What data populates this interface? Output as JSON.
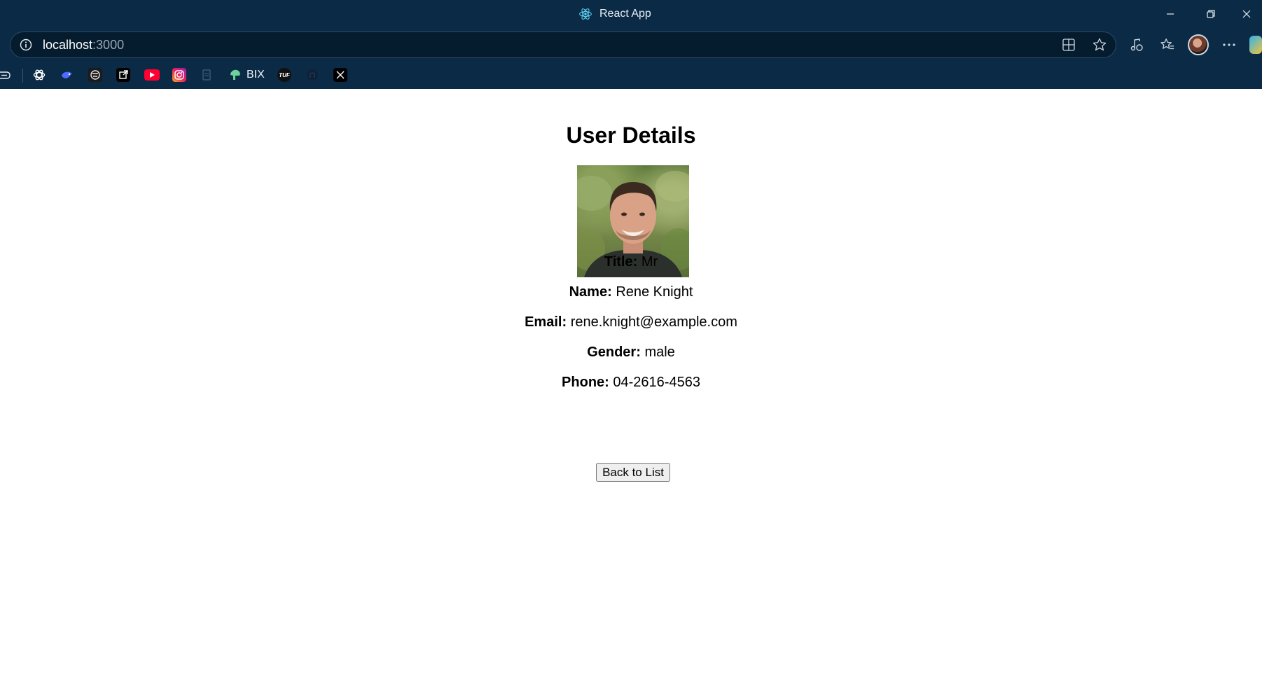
{
  "browser": {
    "tab_title": "React App",
    "address": {
      "host": "localhost",
      "port": ":3000"
    },
    "bookmarks": [
      {
        "icon": "chatgpt-icon"
      },
      {
        "icon": "deepseek-icon"
      },
      {
        "icon": "codechef-icon"
      },
      {
        "icon": "external-link-icon"
      },
      {
        "icon": "youtube-icon"
      },
      {
        "icon": "instagram-icon"
      },
      {
        "icon": "document-icon"
      },
      {
        "icon": "bix-icon",
        "label": "BIX"
      },
      {
        "icon": "tuf-icon"
      },
      {
        "icon": "github-icon"
      },
      {
        "icon": "x-icon"
      }
    ]
  },
  "page": {
    "heading": "User Details",
    "photo": {
      "alt": "User photo"
    },
    "fields": [
      {
        "label": "Title:",
        "value": "Mr"
      },
      {
        "label": "Name:",
        "value": "Rene Knight"
      },
      {
        "label": "Email:",
        "value": "rene.knight@example.com"
      },
      {
        "label": "Gender:",
        "value": "male"
      },
      {
        "label": "Phone:",
        "value": "04-2616-4563"
      }
    ],
    "back_button": "Back to List"
  }
}
